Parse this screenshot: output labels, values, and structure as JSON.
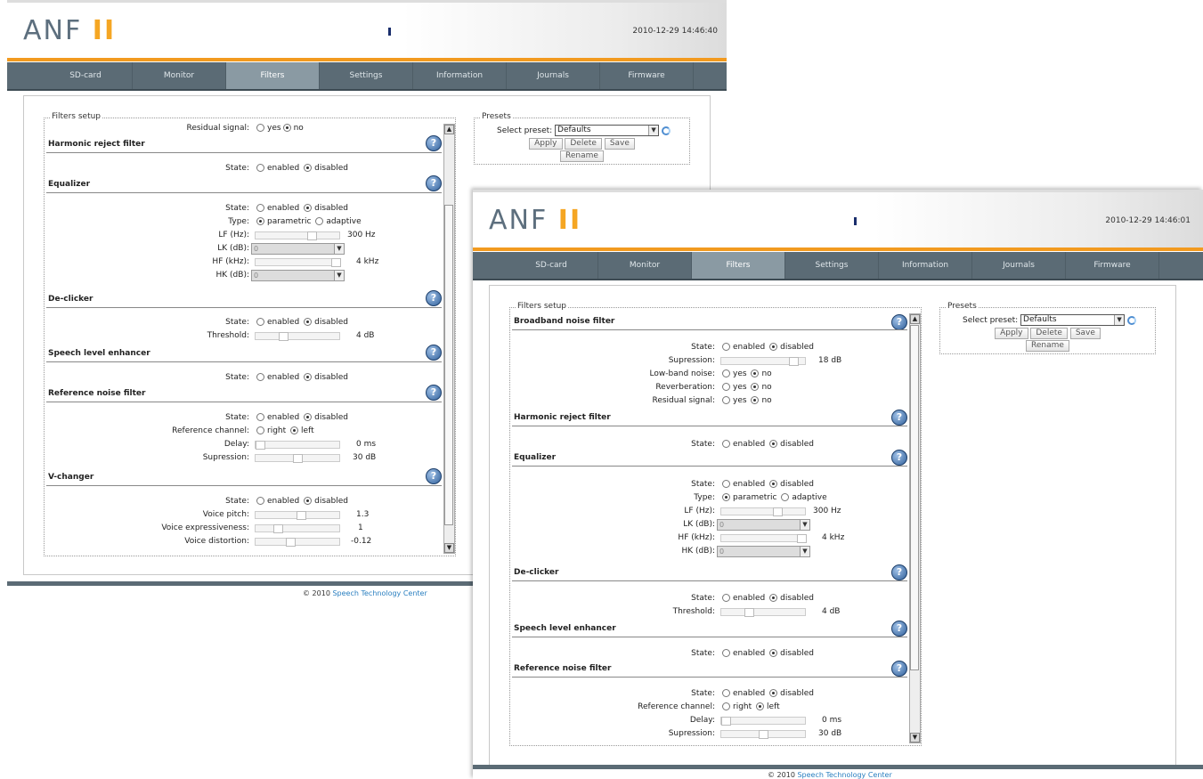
{
  "app": {
    "logo_main": "ANF",
    "logo_num": "II"
  },
  "nav": {
    "tabs": [
      "SD-card",
      "Monitor",
      "Filters",
      "Settings",
      "Information",
      "Journals",
      "Firmware"
    ],
    "active": "Filters"
  },
  "footer": {
    "copyright": "© 2010",
    "link": "Speech Technology Center"
  },
  "common": {
    "help": "?",
    "state": "State:",
    "enabled": "enabled",
    "disabled": "disabled",
    "yes": "yes",
    "no": "no",
    "right": "right",
    "left": "left",
    "parametric": "parametric",
    "adaptive": "adaptive"
  },
  "presets": {
    "legend": "Presets",
    "select_label": "Select preset:",
    "selected": "Defaults",
    "apply": "Apply",
    "delete": "Delete",
    "save": "Save",
    "rename": "Rename"
  },
  "filters": {
    "legend": "Filters setup",
    "broadband": {
      "title": "Broadband noise filter",
      "supression": "Supression:",
      "supression_val": "18 dB",
      "low_band": "Low-band noise:",
      "reverberation": "Reverberation:"
    },
    "residual": "Residual signal:",
    "harmonic": {
      "title": "Harmonic reject filter"
    },
    "equalizer": {
      "title": "Equalizer",
      "type": "Type:",
      "lf": "LF (Hz):",
      "lf_val": "300 Hz",
      "lk": "LK (dB):",
      "lk_val": "0",
      "hf": "HF (kHz):",
      "hf_val": "4 kHz",
      "hk": "HK (dB):",
      "hk_val": "0"
    },
    "declicker": {
      "title": "De-clicker",
      "threshold": "Threshold:",
      "threshold_val": "4 dB"
    },
    "speech": {
      "title": "Speech level enhancer"
    },
    "refnoise": {
      "title": "Reference noise filter",
      "channel": "Reference channel:",
      "delay": "Delay:",
      "delay_val": "0 ms",
      "supression": "Supression:",
      "supression_val": "30 dB"
    },
    "vchanger": {
      "title": "V-changer",
      "pitch": "Voice pitch:",
      "pitch_val": "1.3",
      "express": "Voice expressiveness:",
      "express_val": "1",
      "distortion": "Voice distortion:",
      "distortion_val": "-0.12"
    }
  },
  "window1": {
    "timestamp": "2010-12-29 14:46:40"
  },
  "window2": {
    "timestamp": "2010-12-29 14:46:01"
  }
}
